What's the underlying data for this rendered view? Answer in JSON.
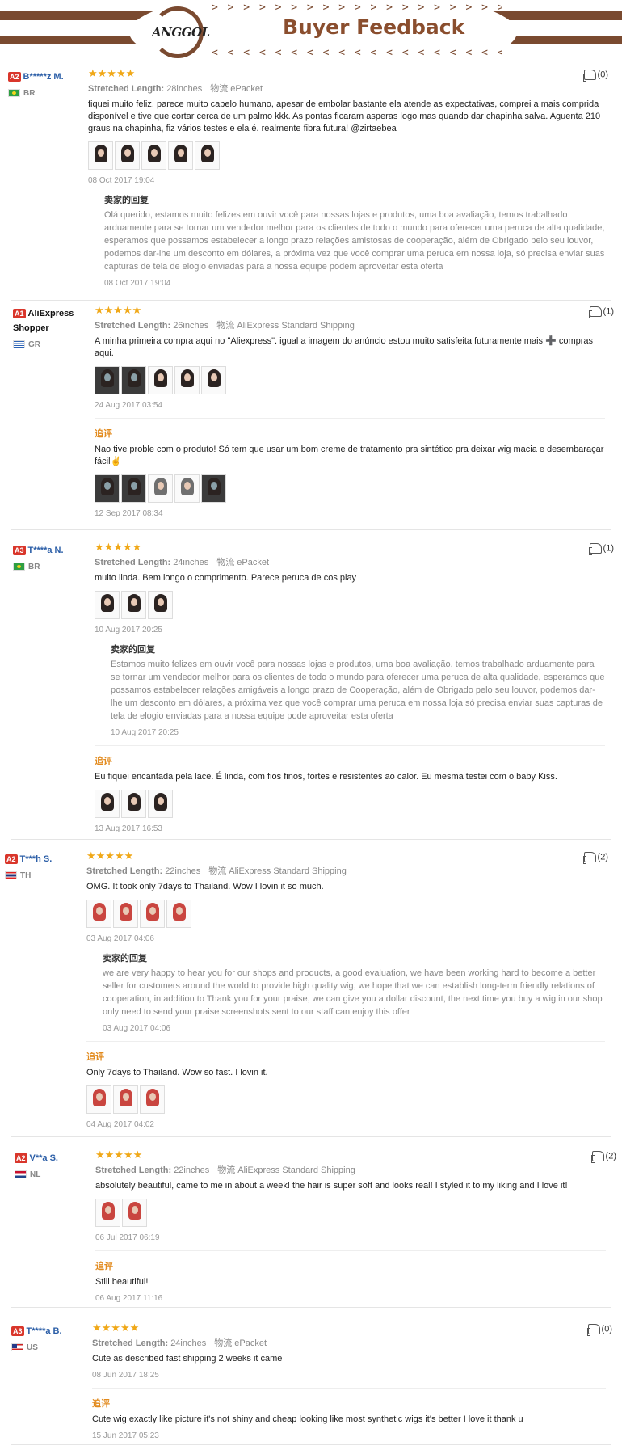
{
  "banner": {
    "logo_text": "ANGGOL",
    "title": "Buyer Feedback",
    "arrows_top": "> > > > > > > > > > > > > > > > > > > > > > >",
    "arrows_bottom": "< < < < < < < < < < < < < < < < < < < < < < <",
    "colors": {
      "brand": "#7a4a30",
      "title": "#8a4e2e"
    }
  },
  "labels": {
    "stretched": "Stretched Length:",
    "logistics": "物流",
    "seller_reply": "卖家的回复",
    "followup": "追评",
    "stars": "★★★★★"
  },
  "reviews": [
    {
      "level": "A2",
      "name": "B*****z M.",
      "flag": "br",
      "country": "BR",
      "helpful": "(0)",
      "length": "28inches",
      "shipping": "ePacket",
      "text": "fiquei muito feliz. parece muito cabelo humano, apesar de embolar bastante ela atende as expectativas, comprei a mais comprida disponível e tive que cortar cerca de um palmo kkk. As pontas ficaram asperas logo mas quando dar chapinha salva. Aguenta 210 graus na chapinha, fiz vários testes e ela é. realmente fibra futura! @zirtaebea",
      "thumbs": 5,
      "thumb_style": "",
      "date": "08 Oct 2017 19:04",
      "reply": "Olá querido, estamos muito felizes em ouvir você para nossas lojas e produtos, uma boa avaliação, temos trabalhado arduamente para se tornar um vendedor melhor para os clientes de todo o mundo para oferecer uma peruca de alta qualidade, esperamos que possamos estabelecer a longo prazo relações amistosas de cooperação, além de Obrigado pelo seu louvor, podemos dar-lhe um desconto em dólares, a próxima vez que você comprar uma peruca em nossa loja, só precisa enviar suas capturas de tela de elogio enviadas para a nossa equipe podem aproveitar esta oferta",
      "reply_date": "08 Oct 2017 19:04"
    },
    {
      "level": "A1",
      "name": "AliExpress Shopper",
      "flag": "gr",
      "country": "GR",
      "helpful": "(1)",
      "length": "26inches",
      "shipping": "AliExpress Standard Shipping",
      "text": "A minha primeira compra aqui no \"Aliexpress\". igual a imagem do anúncio estou muito satisfeita futuramente mais ➕ compras aqui.",
      "thumbs": 5,
      "thumb_style": "dark",
      "date": "24 Aug 2017 03:54",
      "followup": "Nao tive proble com o produto! Só tem que usar um bom creme de tratamento pra sintético pra deixar wig macia e desembaraçar fácil✌",
      "followup_thumbs": 5,
      "followup_date": "12 Sep 2017 08:34"
    },
    {
      "level": "A3",
      "name": "T****a N.",
      "flag": "br",
      "country": "BR",
      "helpful": "(1)",
      "length": "24inches",
      "shipping": "ePacket",
      "text": "muito linda. Bem longo o comprimento. Parece peruca de cos play",
      "thumbs": 3,
      "thumb_style": "",
      "date": "10 Aug 2017 20:25",
      "reply": "Estamos muito felizes em ouvir você para nossas lojas e produtos, uma boa avaliação, temos trabalhado arduamente para se tornar um vendedor melhor para os clientes de todo o mundo para oferecer uma peruca de alta qualidade, esperamos que possamos estabelecer relações amigáveis a longo prazo de Cooperação, além de Obrigado pelo seu louvor, podemos dar-lhe um desconto em dólares, a próxima vez que você comprar uma peruca em nossa loja só precisa enviar suas capturas de tela de elogio enviadas para a nossa equipe pode aproveitar esta oferta",
      "reply_date": "10 Aug 2017 20:25",
      "followup": "Eu fiquei encantada pela lace. É linda, com fios finos, fortes e resistentes ao calor. Eu mesma testei com o baby Kiss.",
      "followup_thumbs": 3,
      "followup_date": "13 Aug 2017 16:53"
    },
    {
      "level": "A2",
      "name": "T***h S.",
      "flag": "th",
      "country": "TH",
      "helpful": "(2)",
      "length": "22inches",
      "shipping": "AliExpress Standard Shipping",
      "text": "OMG. It took only 7days to Thailand. Wow I lovin it so much.",
      "thumbs": 4,
      "thumb_style": "red",
      "date": "03 Aug 2017 04:06",
      "reply": "we are very happy to hear you for our shops and products, a good evaluation, we have been working hard to become a better seller for customers around the world to provide high quality wig, we hope that we can establish long-term friendly relations of cooperation, in addition to Thank you for your praise, we can give you a dollar discount, the next time you buy a wig in our shop only need to send your praise screenshots sent to our staff can enjoy this offer",
      "reply_date": "03 Aug 2017 04:06",
      "followup": "Only 7days to Thailand. Wow so fast. I lovin it.",
      "followup_thumbs": 3,
      "followup_date": "04 Aug 2017 04:02"
    },
    {
      "level": "A2",
      "name": "V**a S.",
      "flag": "nl",
      "country": "NL",
      "helpful": "(2)",
      "length": "22inches",
      "shipping": "AliExpress Standard Shipping",
      "text": "absolutely beautiful, came to me in about a week! the hair is super soft and looks real! I styled it to my liking and I love it!",
      "thumbs": 2,
      "thumb_style": "red",
      "date": "06 Jul 2017 06:19",
      "followup": "Still beautiful!",
      "followup_thumbs": 0,
      "followup_date": "06 Aug 2017 11:16"
    },
    {
      "level": "A3",
      "name": "T****a B.",
      "flag": "us",
      "country": "US",
      "helpful": "(0)",
      "length": "24inches",
      "shipping": "ePacket",
      "text": "Cute as described fast shipping 2 weeks it came",
      "thumbs": 0,
      "thumb_style": "",
      "date": "08 Jun 2017 18:25",
      "followup": "Cute wig exactly like picture it's not shiny and cheap looking like most synthetic wigs it's better I love it thank u",
      "followup_thumbs": 0,
      "followup_date": "15 Jun 2017 05:23"
    }
  ]
}
